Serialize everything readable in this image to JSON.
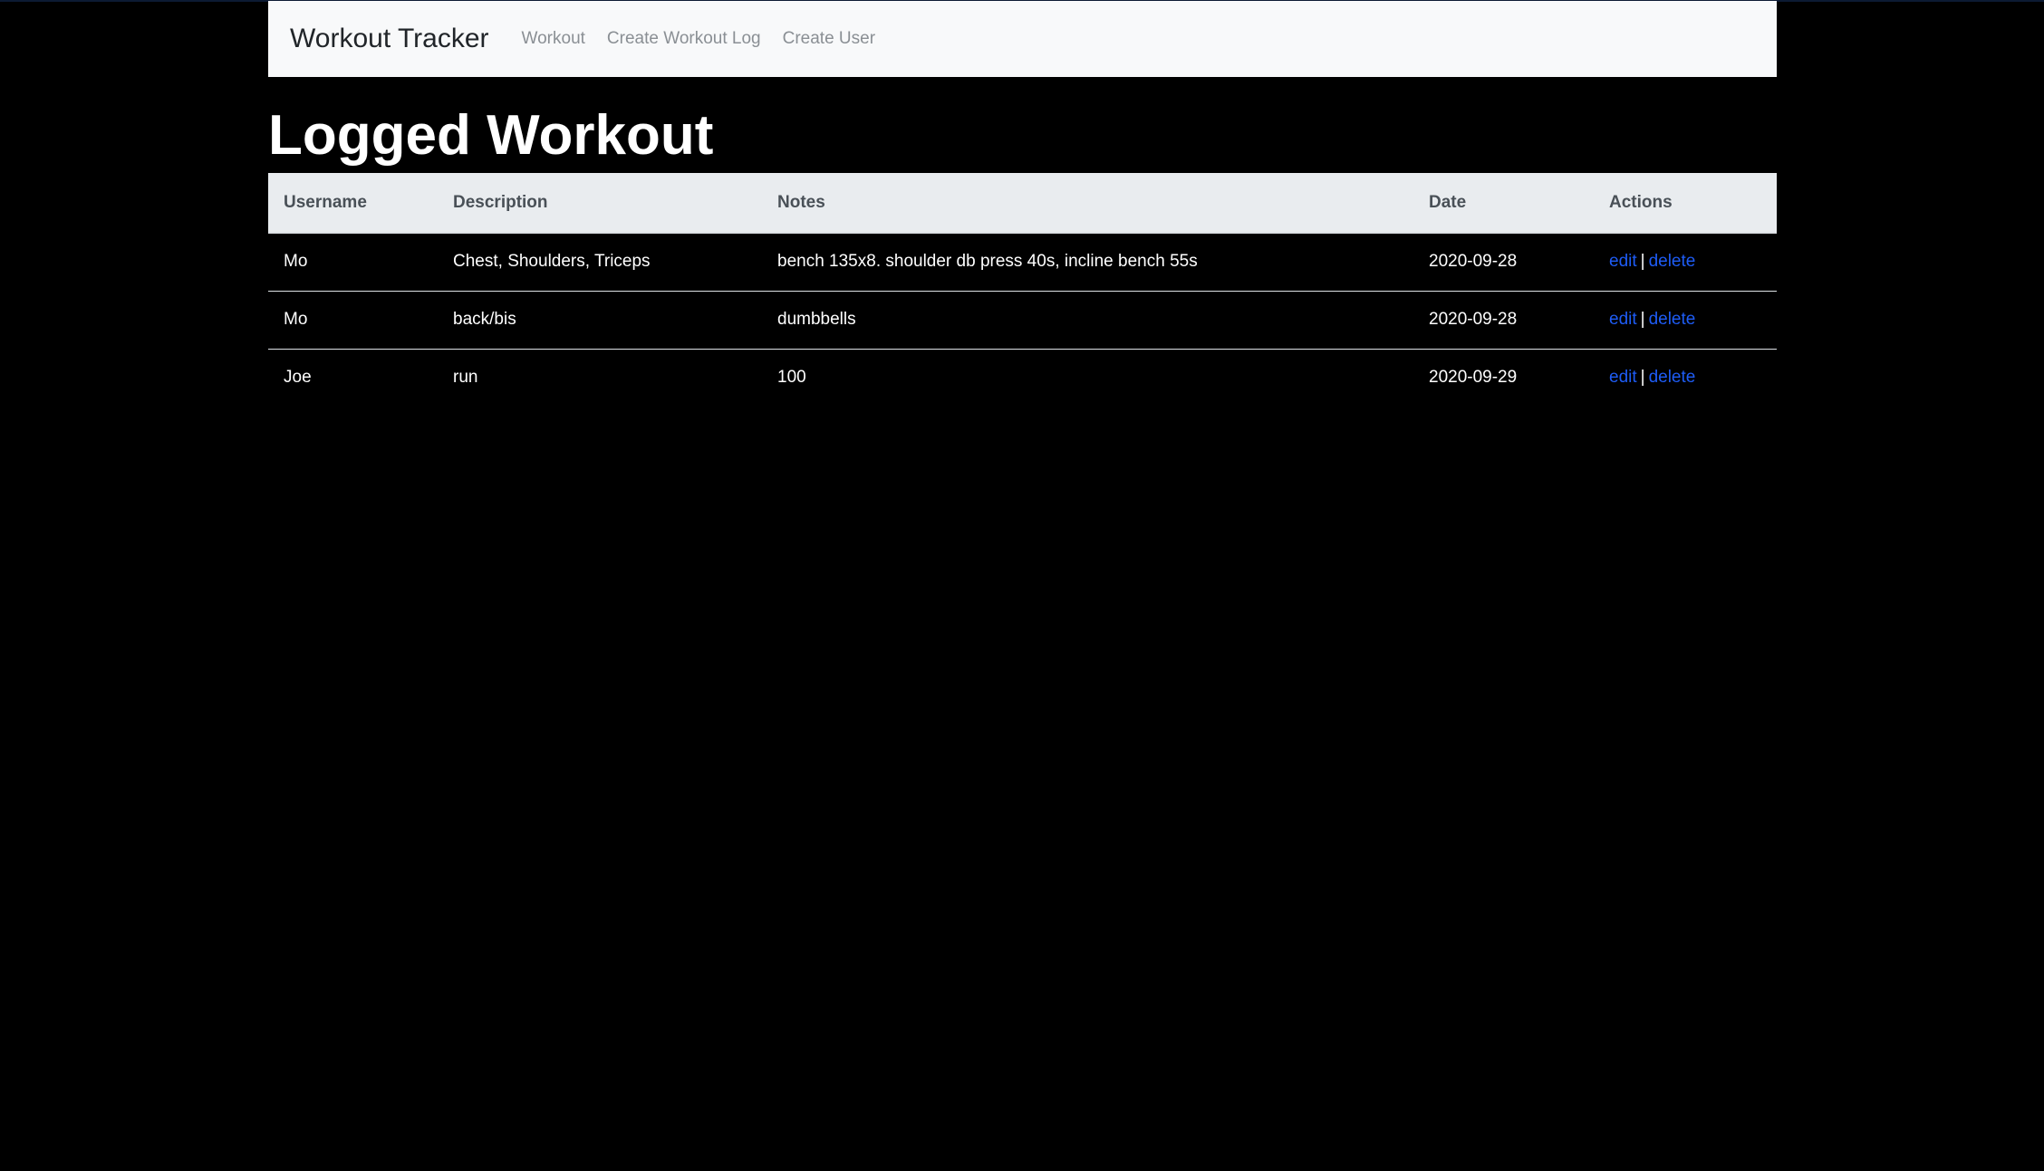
{
  "navbar": {
    "brand": "Workout Tracker",
    "links": [
      "Workout",
      "Create Workout Log",
      "Create User"
    ]
  },
  "page_title": "Logged Workout",
  "table": {
    "headers": [
      "Username",
      "Description",
      "Notes",
      "Date",
      "Actions"
    ],
    "rows": [
      {
        "username": "Mo",
        "description": "Chest, Shoulders, Triceps",
        "notes": "bench 135x8. shoulder db press 40s, incline bench 55s",
        "date": "2020-09-28",
        "edit": "edit",
        "separator": "|",
        "delete": "delete"
      },
      {
        "username": "Mo",
        "description": "back/bis",
        "notes": "dumbbells",
        "date": "2020-09-28",
        "edit": "edit",
        "separator": "|",
        "delete": "delete"
      },
      {
        "username": "Joe",
        "description": "run",
        "notes": "100",
        "date": "2020-09-29",
        "edit": "edit",
        "separator": "|",
        "delete": "delete"
      }
    ]
  },
  "colors": {
    "background": "#000000",
    "navbar_bg": "#f8f9fa",
    "table_header_bg": "#e9ecef",
    "link": "#1e5cf5"
  }
}
